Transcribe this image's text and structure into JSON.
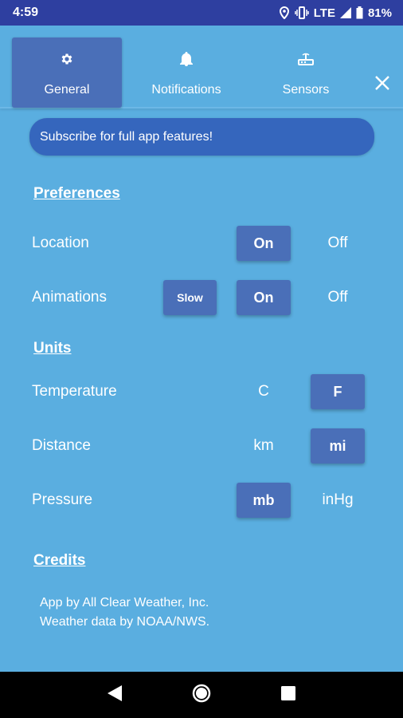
{
  "status": {
    "time": "4:59",
    "network": "LTE",
    "battery": "81%"
  },
  "tabs": [
    {
      "label": "General",
      "icon": "gear-icon"
    },
    {
      "label": "Notifications",
      "icon": "bell-icon"
    },
    {
      "label": "Sensors",
      "icon": "sensor-icon"
    }
  ],
  "subscribe_label": "Subscribe for full app features!",
  "preferences": {
    "title": "Preferences",
    "location": {
      "label": "Location",
      "on": "On",
      "off": "Off",
      "selected": "On"
    },
    "animations": {
      "label": "Animations",
      "slow": "Slow",
      "on": "On",
      "off": "Off",
      "selected": "On"
    }
  },
  "units": {
    "title": "Units",
    "temperature": {
      "label": "Temperature",
      "c": "C",
      "f": "F",
      "selected": "F"
    },
    "distance": {
      "label": "Distance",
      "km": "km",
      "mi": "mi",
      "selected": "mi"
    },
    "pressure": {
      "label": "Pressure",
      "mb": "mb",
      "inhg": "inHg",
      "selected": "mb"
    }
  },
  "credits": {
    "title": "Credits",
    "line1": "App by All Clear Weather, Inc.",
    "line2": "Weather data by NOAA/NWS."
  },
  "colors": {
    "background": "#5aaee0",
    "accent": "#4a6fb8",
    "status_bar": "#2e3fa0",
    "banner": "#3566bd"
  }
}
